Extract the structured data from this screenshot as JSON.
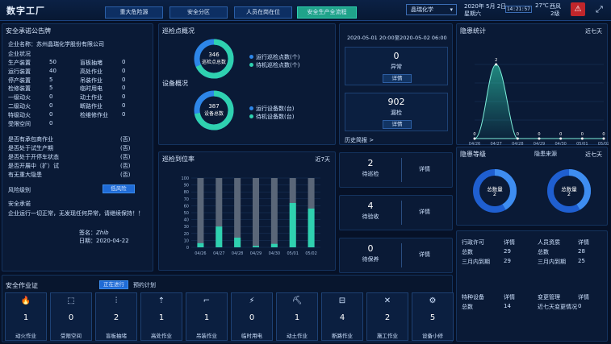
{
  "header": {
    "title": "数字工厂",
    "nav": [
      "重大危险源",
      "安全分区",
      "人员在岗在位",
      "安全生产全流程"
    ],
    "company_select": "晶瑞化学",
    "date": "2020年 5月 2日",
    "weekday": "星期六",
    "time": "14:21:57",
    "temp": "27℃",
    "wind_dir": "西风",
    "wind_level": "2级",
    "warn_icon": "warning-triangle",
    "fullscreen_icon": "fullscreen"
  },
  "bulletin": {
    "title": "安全承诺公告牌",
    "company_label": "企业名称：",
    "company_name": "苏州晶瑞化学股份有限公司",
    "status_title": "企业状况",
    "left_items": [
      {
        "l": "生产装置",
        "v": "50"
      },
      {
        "l": "运行装置",
        "v": "40"
      },
      {
        "l": "停产装置",
        "v": "5"
      },
      {
        "l": "检修装置",
        "v": "5"
      },
      {
        "l": "一级动火",
        "v": "0"
      },
      {
        "l": "二级动火",
        "v": "0"
      },
      {
        "l": "特级动火",
        "v": "0"
      },
      {
        "l": "受限空间",
        "v": "0"
      }
    ],
    "right_items": [
      {
        "l": "盲板抽堵",
        "v": "0"
      },
      {
        "l": "高处作业",
        "v": "0"
      },
      {
        "l": "吊装作业",
        "v": "0"
      },
      {
        "l": "临时用电",
        "v": "0"
      },
      {
        "l": "动土作业",
        "v": "0"
      },
      {
        "l": "断路作业",
        "v": "0"
      },
      {
        "l": "检维修作业",
        "v": "0"
      }
    ],
    "questions": [
      {
        "q": "是否有承包商作业",
        "a": "(否)"
      },
      {
        "q": "是否处于试生产期",
        "a": "(否)"
      },
      {
        "q": "是否处于开停车状态",
        "a": "(否)"
      },
      {
        "q": "是否开展中（扩）试",
        "a": "(否)"
      },
      {
        "q": "有无重大隐患",
        "a": "(否)"
      }
    ],
    "risk_label": "风险级别",
    "risk_value": "低风险",
    "promise_title": "安全承诺",
    "promise_text": "企业运行一切正常，无发现任何异常，请继续保持！！",
    "sign_label": "签名：",
    "sign_value": "Zhib",
    "date_label": "日期：",
    "date_value": "2020-04-22"
  },
  "patrol": {
    "title": "巡检点概况",
    "donut1_value": "346",
    "donut1_label": "巡检点总数",
    "legend1": [
      "运行巡检点数(个)",
      "待机巡检点数(个)"
    ],
    "device_title": "设备概况",
    "donut2_value": "387",
    "donut2_label": "设备总数",
    "legend2": [
      "运行设备数(台)",
      "待机设备数(台)"
    ]
  },
  "range": {
    "text": "2020-05-01 20:00至2020-05-02 06:00",
    "abnormal_value": "0",
    "abnormal_label": "异常",
    "missed_value": "902",
    "missed_label": "漏检",
    "detail": "详情",
    "history": "历史简报 >"
  },
  "rate": {
    "title": "巡检到位率",
    "right": "近7天"
  },
  "chart_data": {
    "type": "bar",
    "categories": [
      "04/26",
      "04/27",
      "04/28",
      "04/29",
      "04/30",
      "05/01",
      "05/02"
    ],
    "series": [
      {
        "values": [
          100,
          100,
          100,
          100,
          100,
          100,
          100
        ]
      },
      {
        "values": [
          6,
          30,
          14,
          2,
          5,
          64,
          56
        ]
      }
    ],
    "ylim": [
      0,
      100
    ],
    "yticks": [
      "0",
      "10",
      "20",
      "30",
      "40",
      "50",
      "60",
      "70",
      "80",
      "90",
      "100"
    ]
  },
  "tasks": [
    {
      "value": "2",
      "label": "待巡检"
    },
    {
      "value": "4",
      "label": "待验收"
    },
    {
      "value": "0",
      "label": "待保养"
    }
  ],
  "hazard": {
    "title": "隐患统计",
    "right": "近七天",
    "xticks": [
      "04/26",
      "04/27",
      "04/28",
      "04/29",
      "04/30",
      "05/01",
      "05/02"
    ],
    "values": [
      0,
      2,
      0,
      0,
      0,
      0,
      0
    ]
  },
  "level": {
    "title": "隐患等级",
    "source_title": "隐患来源",
    "right": "近七天",
    "d1_label": "总数量",
    "d1_value": "2",
    "d2_label": "总数量",
    "d2_value": "2"
  },
  "permits": {
    "rows": [
      {
        "a": "行政许可",
        "b": "详情",
        "c": "人员资质",
        "d": "详情"
      },
      {
        "a": "总数",
        "b": "29",
        "c": "总数",
        "d": "28"
      },
      {
        "a": "三月内到期",
        "b": "29",
        "c": "三月内到期",
        "d": "25"
      }
    ],
    "rows2": [
      {
        "a": "特种设备",
        "b": "详情",
        "c": "变更管理",
        "d": "详情"
      },
      {
        "a": "总数",
        "b": "14",
        "c": "近七天变更情况",
        "d": "0"
      }
    ]
  },
  "work": {
    "title": "安全作业证",
    "tabs": [
      "正在进行",
      "预约计划"
    ],
    "cards": [
      {
        "icon": "fire-icon",
        "n": "1",
        "l": "动火作业"
      },
      {
        "icon": "space-icon",
        "n": "0",
        "l": "受限空间"
      },
      {
        "icon": "blind-icon",
        "n": "2",
        "l": "盲板抽堵"
      },
      {
        "icon": "height-icon",
        "n": "1",
        "l": "高处作业"
      },
      {
        "icon": "crane-icon",
        "n": "1",
        "l": "吊装作业"
      },
      {
        "icon": "power-icon",
        "n": "0",
        "l": "临时用电"
      },
      {
        "icon": "dig-icon",
        "n": "1",
        "l": "动土作业"
      },
      {
        "icon": "road-icon",
        "n": "4",
        "l": "断路作业"
      },
      {
        "icon": "tool-icon",
        "n": "2",
        "l": "施工作业"
      },
      {
        "icon": "repair-icon",
        "n": "5",
        "l": "设备小修"
      }
    ]
  }
}
